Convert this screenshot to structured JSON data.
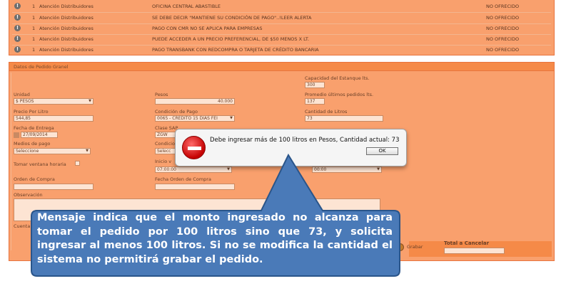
{
  "rows": [
    {
      "num": "1",
      "category": "Atención Distribuidores",
      "description": "OFICINA CENTRAL ABASTIBLE",
      "status": "NO OFRECIDO"
    },
    {
      "num": "1",
      "category": "Atención Distribuidores",
      "description": "SE DEBE DECIR \"MANTIENE SU CONDICIÓN DE PAGO\"..!LEER ALERTA",
      "status": "NO OFRECIDO"
    },
    {
      "num": "1",
      "category": "Atención Distribuidores",
      "description": "PAGO CON CMR NO SE APLICA PARA EMPRESAS",
      "status": "NO OFRECIDO"
    },
    {
      "num": "1",
      "category": "Atención Distribuidores",
      "description": "PUEDE ACCEDER A UN PRECIO PREFERENCIAL, DE $50 MENOS X LT.",
      "status": "NO OFRECIDO"
    },
    {
      "num": "1",
      "category": "Atención Distribuidores",
      "description": "PAGO TRANSBANK CON REDCOMPRA O TARJETA DE CRÉDITO BANCARIA",
      "status": "NO OFRECIDO"
    }
  ],
  "form": {
    "title": "Datos de Pedido Granel",
    "capacidad_label": "Capacidad del Estanque lts.",
    "capacidad_value": "300",
    "promedio_label": "Promedio últimos pedidos lts.",
    "promedio_value": "137",
    "cantidad_label": "Cantidad de Litros",
    "cantidad_value": "73",
    "unidad_label": "Unidad",
    "unidad_value": "$ PESOS",
    "pesos_label": "Pesos",
    "pesos_value": "40.000",
    "precio_label": "Precio Por Litro",
    "precio_value": "544,85",
    "condicion_label": "Condición de Pago",
    "condicion_value": "0065 - CREDITO 15 DIAS FEI",
    "fecha_label": "Fecha de Entrega",
    "fecha_value": "27/09/2014",
    "clase_label": "Clase SAP",
    "clase_value": "ZGW",
    "medios_label": "Medios de pago",
    "medios_value": "Seleccione",
    "condicion2_label": "Condicio",
    "condicion2_value": "Selecc",
    "ventana_label": "Tomar ventana horaria",
    "inicio_label": "Inicio v",
    "inicio_value": "07:00:00",
    "fin_value": "00:00",
    "orden_label": "Orden de Compra",
    "fecha_orden_label": "Fecha Orden de Compra",
    "observacion_label": "Observación",
    "cuenta_label": "Cuenta",
    "grabar_label": "Grabar",
    "total_label": "Total a Cancelar"
  },
  "dialog": {
    "message": "Debe ingresar más de 100 litros en Pesos, Cantidad actual: 73",
    "ok_label": "OK"
  },
  "callout": {
    "text": "Mensaje indica que el monto ingresado no alcanza para tomar el pedido por 100 litros sino que 73, y solicita ingresar al menos 100 litros. Si no se modifica la cantidad el sistema no permitirá grabar el pedido."
  }
}
